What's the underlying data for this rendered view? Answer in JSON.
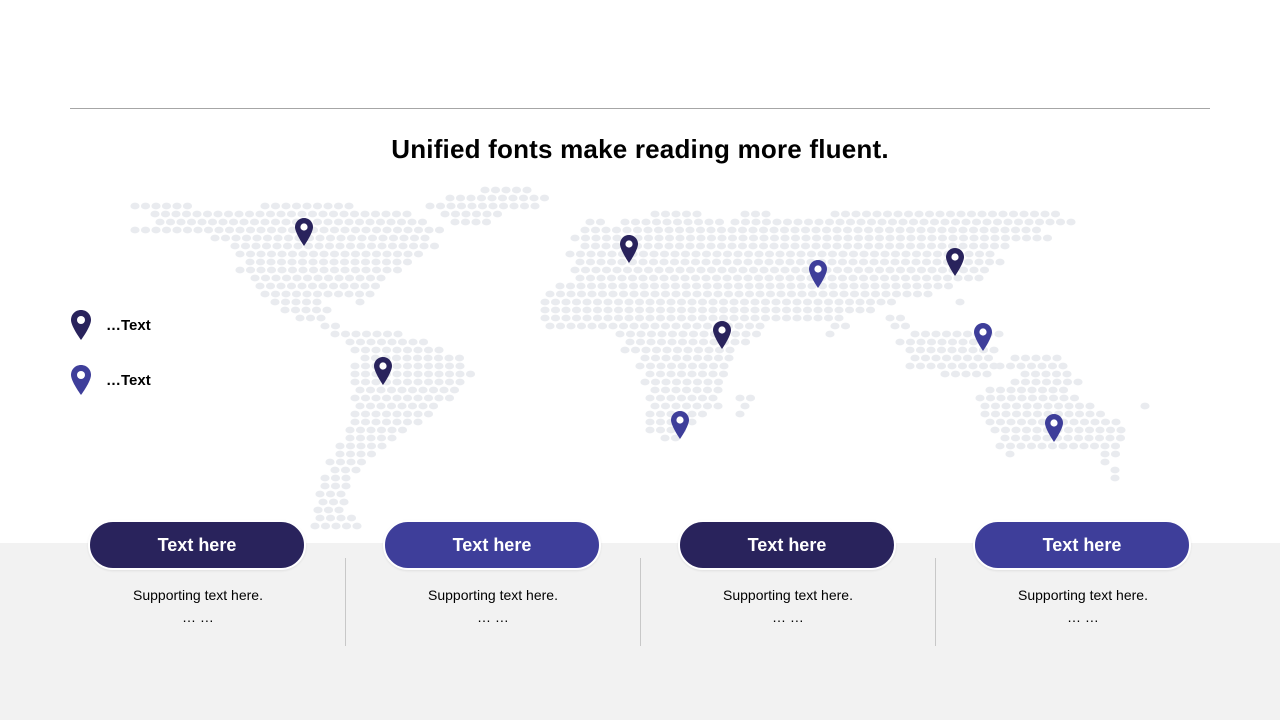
{
  "title": "Unified fonts make reading more fluent.",
  "colors": {
    "dark": "#29235c",
    "light": "#3e3e9a",
    "map_dot": "#e9ebef",
    "band": "#f2f2f2"
  },
  "legend": [
    {
      "label": "…Text",
      "color": "dark",
      "icon": "map-pin-icon"
    },
    {
      "label": "…Text",
      "color": "light",
      "icon": "map-pin-icon"
    }
  ],
  "columns": [
    {
      "button": "Text here",
      "color": "dark",
      "line1": "Supporting  text here.",
      "line2": "… …"
    },
    {
      "button": "Text here",
      "color": "light",
      "line1": "Supporting  text here.",
      "line2": "… …"
    },
    {
      "button": "Text here",
      "color": "dark",
      "line1": "Supporting  text here.",
      "line2": "… …"
    },
    {
      "button": "Text here",
      "color": "light",
      "line1": "Supporting  text here.",
      "line2": "… …"
    }
  ],
  "map_pins": [
    {
      "region": "north-america",
      "color": "dark"
    },
    {
      "region": "south-america",
      "color": "dark"
    },
    {
      "region": "europe",
      "color": "dark"
    },
    {
      "region": "africa",
      "color": "dark"
    },
    {
      "region": "southern-africa",
      "color": "light"
    },
    {
      "region": "central-asia",
      "color": "light"
    },
    {
      "region": "east-asia",
      "color": "dark"
    },
    {
      "region": "southeast-asia",
      "color": "light"
    },
    {
      "region": "australia",
      "color": "light"
    }
  ]
}
